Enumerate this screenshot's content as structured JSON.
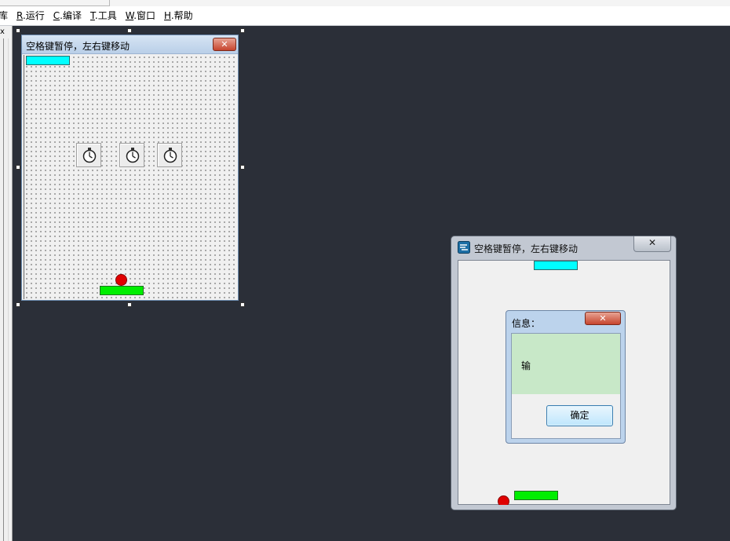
{
  "menu": {
    "items": [
      {
        "accel": "",
        "label": "库"
      },
      {
        "accel": "R",
        "label": ".运行"
      },
      {
        "accel": "C",
        "label": ".编译"
      },
      {
        "accel": "T",
        "label": ".工具"
      },
      {
        "accel": "W",
        "label": ".窗口"
      },
      {
        "accel": "H",
        "label": ".帮助"
      }
    ]
  },
  "left_panel": {
    "close_glyph": "x"
  },
  "designer": {
    "title": "空格键暂停，左右键移动",
    "close_glyph": "✕",
    "timer_icon": "stopwatch-icon",
    "timer_count": 3
  },
  "run_window": {
    "title": "空格键暂停，左右键移动",
    "close_glyph": "✕"
  },
  "dialog": {
    "title": "信息：",
    "close_glyph": "✕",
    "message": "输",
    "ok_label": "确定"
  },
  "colors": {
    "desktop": "#2b2f38",
    "paddle_top": "#00ffff",
    "paddle_bottom": "#00ee00",
    "ball": "#e00000",
    "message_bg": "#c8e8c8"
  }
}
